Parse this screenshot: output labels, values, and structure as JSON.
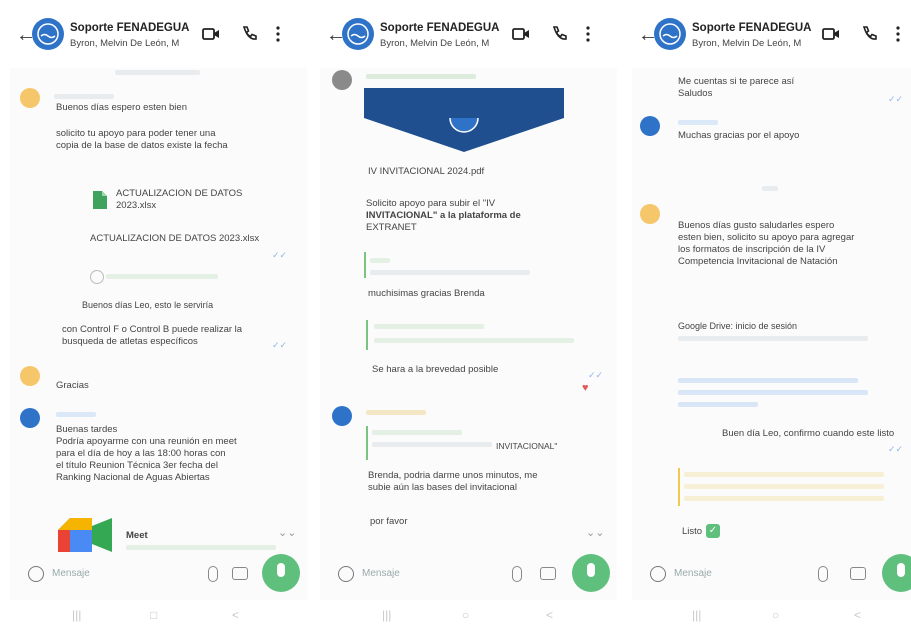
{
  "chat": {
    "title": "Soporte FENADEGUA",
    "subtitle": "Byron, Melvin De León, M",
    "input_placeholder": "Mensaje",
    "colors": {
      "header_bg": "#ffffff",
      "mic_button": "#5fbf7d",
      "avatar": "#2f73c9",
      "link": "#3b7fd4"
    }
  },
  "panel1": {
    "m1": "Buenos días espero esten bien",
    "m2a": "solicito tu apoyo para poder tener una",
    "m2b": "copia de la base de datos existe la fecha",
    "file_name": "ACTUALIZACION DE DATOS",
    "file_ext": "2023.xlsx",
    "file_caption": "ACTUALIZACION DE DATOS 2023.xlsx",
    "m3": "Buenos días Leo, esto le serviría",
    "m4a": "con Control F o Control B puede realizar la",
    "m4b": "busqueda de atletas específicos",
    "m5": "Gracias",
    "m6a": "Buenas tardes",
    "m6b": "Podría apoyarme con una reunión en meet",
    "m6c": "para el día de hoy a las 18:00 horas con",
    "m6d": "el título Reunion Técnica 3er fecha del",
    "m6e": "Ranking Nacional de Aguas Abiertas",
    "meet_label": "Meet"
  },
  "panel2": {
    "file_name": "IV INVITACIONAL 2024.pdf",
    "m1a": "Solicito apoyo para subir el \"IV",
    "m1b": "INVITACIONAL\" a la plataforma de",
    "m1c": "EXTRANET",
    "m2": "muchisimas gracias Brenda",
    "m3": "Se hara a la brevedad posible",
    "m4a": "INVITACIONAL\"",
    "m5a": "Brenda, podria darme unos minutos, me",
    "m5b": "subie aún las bases del invitacional",
    "m6": "por favor"
  },
  "panel3": {
    "m1a": "Me cuentas si te parece así",
    "m1b": "Saludos",
    "m2": "Muchas gracias por el apoyo",
    "m3a": "Buenos días gusto saludarles espero",
    "m3b": "esten bien, solicito su apoyo para agregar",
    "m3c": "los formatos de inscripción de la IV",
    "m3d": "Competencia Invitacional de Natación",
    "m4": "Google Drive: inicio de sesión",
    "m5": "Buen día Leo, confirmo cuando este listo",
    "m6": "Listo"
  }
}
